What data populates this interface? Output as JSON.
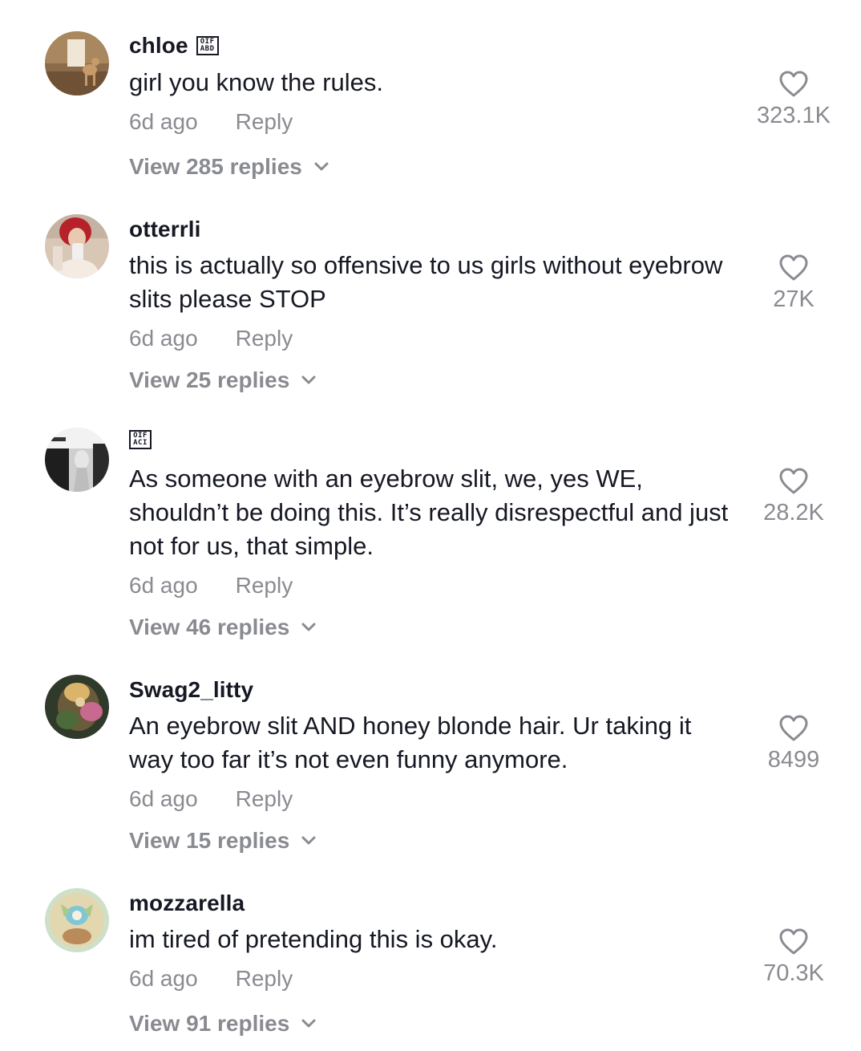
{
  "comments": [
    {
      "username": "chloe",
      "badge": {
        "top": "OIF",
        "bottom": "ABD"
      },
      "text": "girl you know the rules.",
      "time": "6d ago",
      "reply_label": "Reply",
      "view_replies": "View 285 replies",
      "likes": "323.1K"
    },
    {
      "username": "otterrli",
      "text": "this is actually so offensive to us girls without eyebrow slits please STOP",
      "time": "6d ago",
      "reply_label": "Reply",
      "view_replies": "View 25 replies",
      "likes": "27K"
    },
    {
      "username": "",
      "badge": {
        "top": "OIF",
        "bottom": "ACI"
      },
      "text": "As someone with an eyebrow slit, we, yes WE, shouldn’t be doing this. It’s really disrespectful and just not for us, that simple.",
      "time": "6d ago",
      "reply_label": "Reply",
      "view_replies": "View 46 replies",
      "likes": "28.2K"
    },
    {
      "username": "Swag2_litty",
      "text": "An eyebrow slit AND honey blonde hair. Ur taking it way too far it’s not even funny anymore.",
      "time": "6d ago",
      "reply_label": "Reply",
      "view_replies": "View 15 replies",
      "likes": "8499"
    },
    {
      "username": "mozzarella",
      "text": "im tired of pretending this is okay.",
      "time": "6d ago",
      "reply_label": "Reply",
      "view_replies": "View 91 replies",
      "likes": "70.3K"
    }
  ],
  "icons": {
    "like": "heart-outline-icon",
    "expand": "chevron-down-icon"
  },
  "colors": {
    "primary_text": "#161823",
    "secondary_text": "#8a8b91",
    "background": "#ffffff"
  }
}
